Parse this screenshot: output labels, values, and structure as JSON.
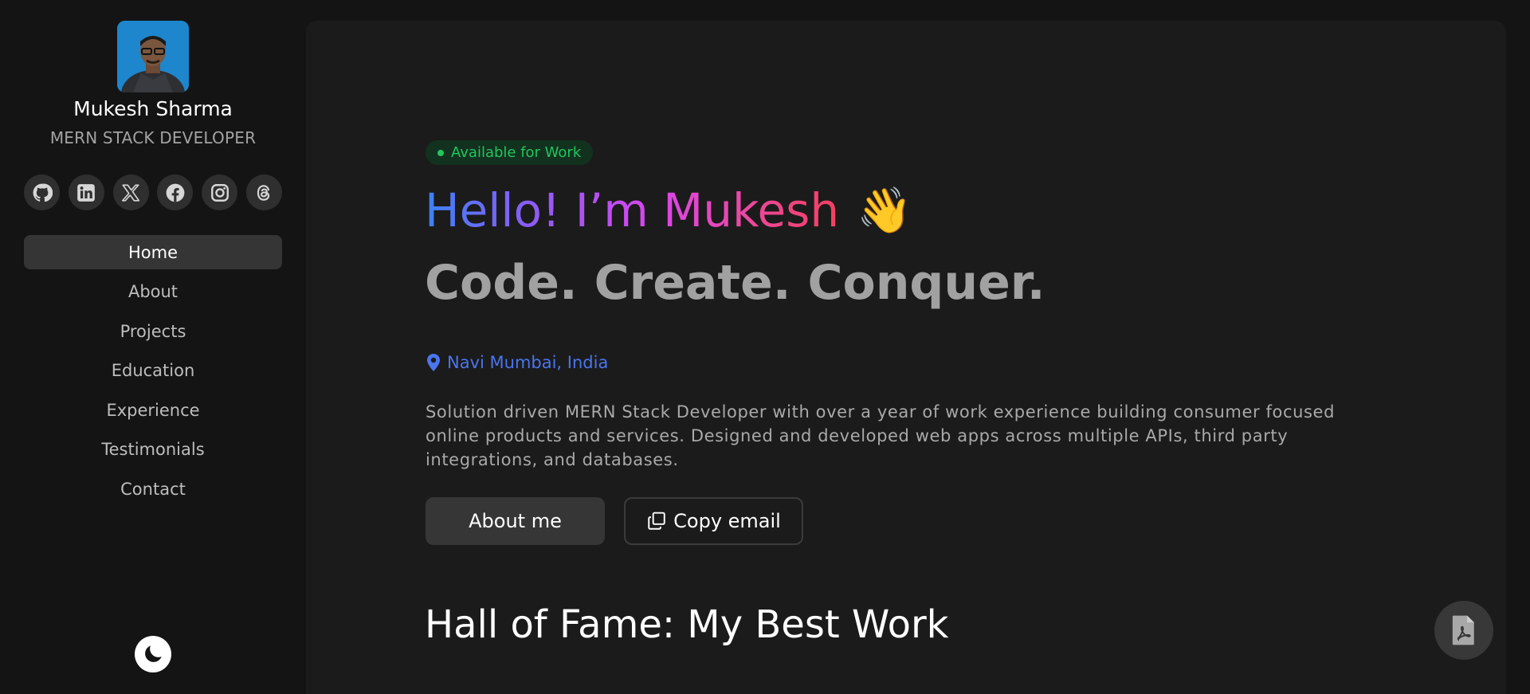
{
  "profile": {
    "name": "Mukesh Sharma",
    "role": "MERN STACK DEVELOPER",
    "avatar_icon": "profile-photo"
  },
  "socials": [
    {
      "name": "github",
      "icon": "github-icon"
    },
    {
      "name": "linkedin",
      "icon": "linkedin-icon"
    },
    {
      "name": "x",
      "icon": "x-icon"
    },
    {
      "name": "facebook",
      "icon": "facebook-icon"
    },
    {
      "name": "instagram",
      "icon": "instagram-icon"
    },
    {
      "name": "threads",
      "icon": "threads-icon"
    }
  ],
  "nav": {
    "items": [
      {
        "label": "Home",
        "active": true
      },
      {
        "label": "About"
      },
      {
        "label": "Projects"
      },
      {
        "label": "Education"
      },
      {
        "label": "Experience"
      },
      {
        "label": "Testimonials"
      },
      {
        "label": "Contact"
      }
    ]
  },
  "theme_toggle": {
    "icon": "moon-icon"
  },
  "hero": {
    "badge": "Available for Work",
    "greeting": "Hello! I’m Mukesh",
    "wave_emoji": "👋",
    "tagline": "Code. Create. Conquer.",
    "location": "Navi Mumbai, India",
    "bio": "Solution driven MERN Stack Developer with over a year of work experience building consumer focused online products and services. Designed and developed web apps across multiple APIs, third party integrations, and databases.",
    "about_button": "About me",
    "copy_button": "Copy email"
  },
  "section": {
    "title": "Hall of Fame: My Best Work"
  },
  "fab": {
    "icon": "pdf-file-icon"
  },
  "colors": {
    "accent_green": "#22c55e",
    "accent_blue": "#4a75ee",
    "gradient": [
      "#3b82f6",
      "#8b5cf6",
      "#d946ef",
      "#ec4899",
      "#f43f5e"
    ]
  }
}
